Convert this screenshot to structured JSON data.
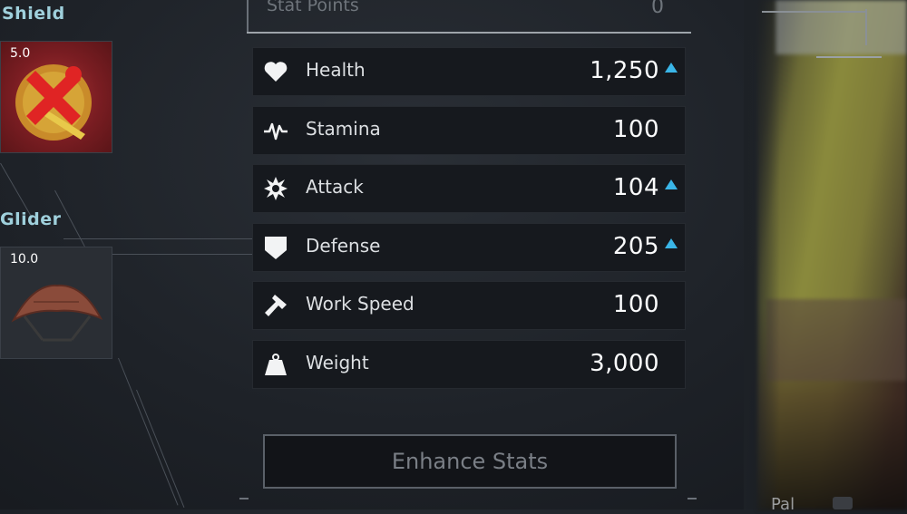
{
  "equipment": {
    "shield": {
      "label": "Shield",
      "level": "5.0"
    },
    "glider": {
      "label": "Glider",
      "level": "10.0"
    }
  },
  "stat_points": {
    "label": "Stat Points",
    "value": "0"
  },
  "stats": [
    {
      "name": "Health",
      "value": "1,250",
      "icon": "heart-icon",
      "increased": true
    },
    {
      "name": "Stamina",
      "value": "100",
      "icon": "pulse-icon",
      "increased": false
    },
    {
      "name": "Attack",
      "value": "104",
      "icon": "burst-icon",
      "increased": true
    },
    {
      "name": "Defense",
      "value": "205",
      "icon": "shield-icon",
      "increased": true
    },
    {
      "name": "Work Speed",
      "value": "100",
      "icon": "hammer-icon",
      "increased": false
    },
    {
      "name": "Weight",
      "value": "3,000",
      "icon": "weight-icon",
      "increased": false
    }
  ],
  "actions": {
    "enhance_label": "Enhance Stats"
  },
  "world_hud": {
    "pal_label": "Pal"
  },
  "colors": {
    "accent_up": "#3ab6e8",
    "slot_shield_bg": "#7a1d22"
  }
}
